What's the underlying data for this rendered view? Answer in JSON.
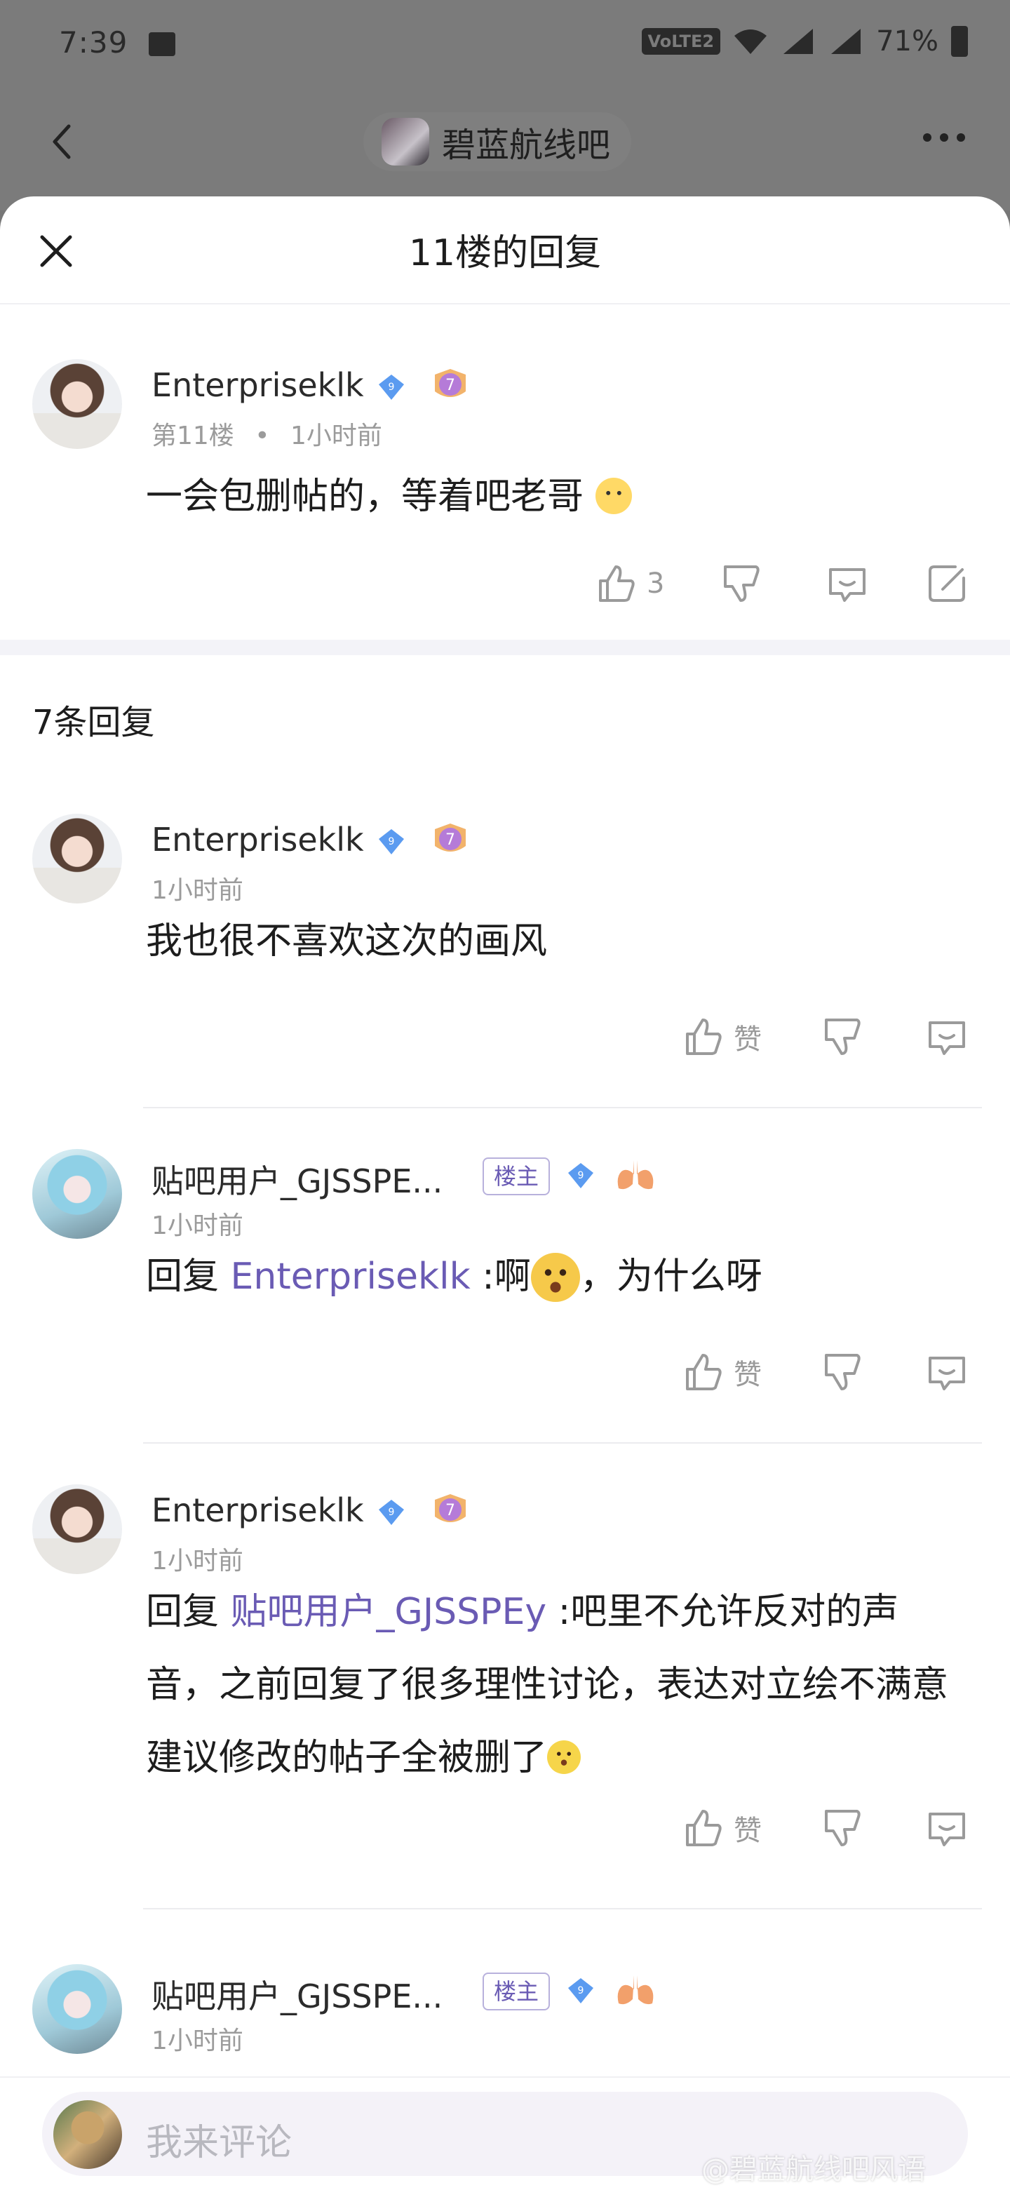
{
  "status_bar": {
    "time": "7:39",
    "network_badge": "VoLTE2",
    "battery": "71%"
  },
  "nav": {
    "forum_name": "碧蓝航线吧"
  },
  "sheet": {
    "title": "11楼的回复"
  },
  "main_post": {
    "username": "Enterpriseklk",
    "level": "7",
    "floor": "第11楼",
    "dot": "•",
    "time": "1小时前",
    "content": "一会包删帖的，等着吧老哥",
    "likes": "3"
  },
  "replies_header": "7条回复",
  "replies": [
    {
      "username": "Enterpriseklk",
      "level": "7",
      "time": "1小时前",
      "content": "我也很不喜欢这次的画风",
      "like_label": "赞"
    },
    {
      "username": "贴吧用户_GJSSPE...",
      "owner_badge": "楼主",
      "time": "1小时前",
      "reply_prefix": "回复 ",
      "mention": "Enterpriseklk",
      "content": " :啊",
      "content_tail": "，为什么呀",
      "like_label": "赞"
    },
    {
      "username": "Enterpriseklk",
      "level": "7",
      "time": "1小时前",
      "reply_prefix": "回复 ",
      "mention": "贴吧用户_GJSSPEy",
      "content": " :吧里不允许反对的声音，之前回复了很多理性讨论，表达对立绘不满意建议修改的帖子全被删了",
      "like_label": "赞"
    },
    {
      "username": "贴吧用户_GJSSPE...",
      "owner_badge": "楼主",
      "time": "1小时前"
    }
  ],
  "comment_bar": {
    "placeholder": "我来评论"
  },
  "watermark": "@碧蓝航线吧风语",
  "colors": {
    "accent": "#6a5bb4",
    "diamond": "#5b9bf0",
    "level_badge": "#b57bd8",
    "meta_gray": "#9b9b9b"
  }
}
